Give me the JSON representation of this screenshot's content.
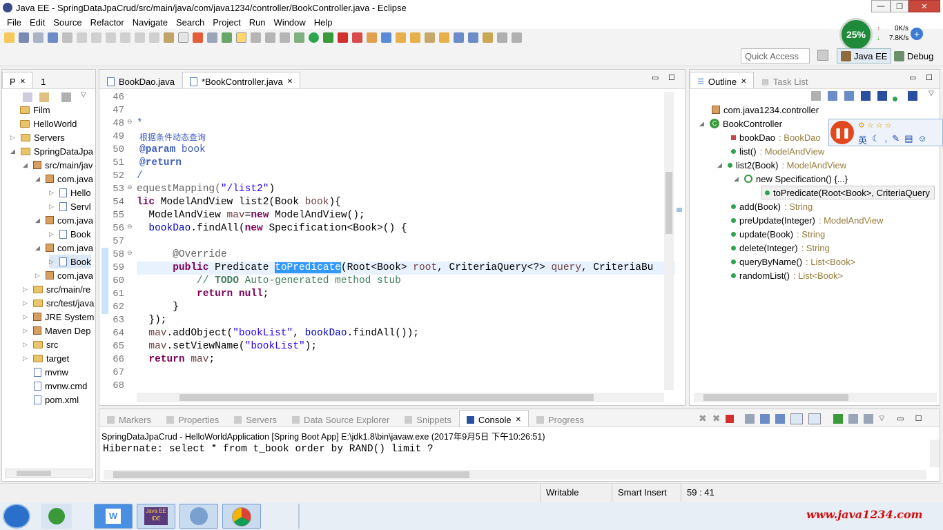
{
  "window": {
    "title": "Java EE - SpringDataJpaCrud/src/main/java/com/java1234/controller/BookController.java - Eclipse"
  },
  "menu": [
    "File",
    "Edit",
    "Source",
    "Refactor",
    "Navigate",
    "Search",
    "Project",
    "Run",
    "Window",
    "Help"
  ],
  "quick_access": "Quick Access",
  "perspectives": {
    "javaee": "Java EE",
    "debug": "Debug"
  },
  "netmon": {
    "percent": "25%",
    "up": "0K/s",
    "down": "7.8K/s"
  },
  "explorer": {
    "tab_p": "P",
    "tab_2": "1",
    "items": [
      {
        "label": "Film",
        "icon": "folder"
      },
      {
        "label": "HelloWorld",
        "icon": "folder"
      },
      {
        "label": "Servers",
        "icon": "folder"
      },
      {
        "label": "SpringDataJpa",
        "icon": "folder"
      },
      {
        "label": "src/main/jav",
        "icon": "pkg"
      },
      {
        "label": "com.java",
        "icon": "pkg"
      },
      {
        "label": "Hello",
        "icon": "jfile"
      },
      {
        "label": "Servl",
        "icon": "jfile"
      },
      {
        "label": "com.java",
        "icon": "pkg"
      },
      {
        "label": "Book",
        "icon": "jfile"
      },
      {
        "label": "com.java",
        "icon": "pkg"
      },
      {
        "label": "Book",
        "icon": "jfile"
      },
      {
        "label": "com.java",
        "icon": "pkg"
      },
      {
        "label": "src/main/re",
        "icon": "folder"
      },
      {
        "label": "src/test/java",
        "icon": "folder"
      },
      {
        "label": "JRE System",
        "icon": "pkg"
      },
      {
        "label": "Maven Dep",
        "icon": "pkg"
      },
      {
        "label": "src",
        "icon": "folder"
      },
      {
        "label": "target",
        "icon": "folder"
      },
      {
        "label": "mvnw",
        "icon": "jfile"
      },
      {
        "label": "mvnw.cmd",
        "icon": "jfile"
      },
      {
        "label": "pom.xml",
        "icon": "jfile"
      }
    ]
  },
  "editor": {
    "tabs": [
      {
        "label": "BookDao.java"
      },
      {
        "label": "*BookController.java"
      }
    ],
    "line_numbers": [
      "46",
      "47",
      "48",
      "49",
      "50",
      "51",
      "52",
      "53",
      "54",
      "55",
      "56",
      "57",
      "58",
      "59",
      "60",
      "61",
      "62",
      "63",
      "64",
      "65",
      "66",
      "67",
      "68"
    ]
  },
  "outline": {
    "tab": "Outline",
    "tab2": "Task List",
    "pkg": "com.java1234.controller",
    "cls": "BookController",
    "members": [
      {
        "name": "bookDao",
        "type": " : BookDao"
      },
      {
        "name": "list()",
        "type": " : ModelAndView"
      },
      {
        "name": "list2(Book)",
        "type": " : ModelAndView"
      },
      {
        "name": "new Specification() {...}",
        "type": ""
      },
      {
        "name": "toPredicate(Root<Book>, CriteriaQuery",
        "type": ""
      },
      {
        "name": "add(Book)",
        "type": " : String"
      },
      {
        "name": "preUpdate(Integer)",
        "type": " : ModelAndView"
      },
      {
        "name": "update(Book)",
        "type": " : String"
      },
      {
        "name": "delete(Integer)",
        "type": " : String"
      },
      {
        "name": "queryByName()",
        "type": " : List<Book>"
      },
      {
        "name": "randomList()",
        "type": " : List<Book>"
      }
    ]
  },
  "console": {
    "tabs": [
      "Markers",
      "Properties",
      "Servers",
      "Data Source Explorer",
      "Snippets",
      "Console",
      "Progress"
    ],
    "header": "SpringDataJpaCrud - HelloWorldApplication [Spring Boot App] E:\\jdk1.8\\bin\\javaw.exe (2017年9月5日 下午10:26:51)",
    "output": "Hibernate: select * from t_book order by RAND() limit ?"
  },
  "statusbar": {
    "writable": "Writable",
    "insert": "Smart Insert",
    "pos": "59 : 41"
  },
  "ime": {
    "lang": "英"
  },
  "watermark": "www.java1234.com",
  "colors": {
    "keyword": "#7f0055",
    "comment": "#3f7f5f",
    "javadoc": "#3f5fbf",
    "string": "#2a00ff",
    "selection": "#3399ff"
  }
}
